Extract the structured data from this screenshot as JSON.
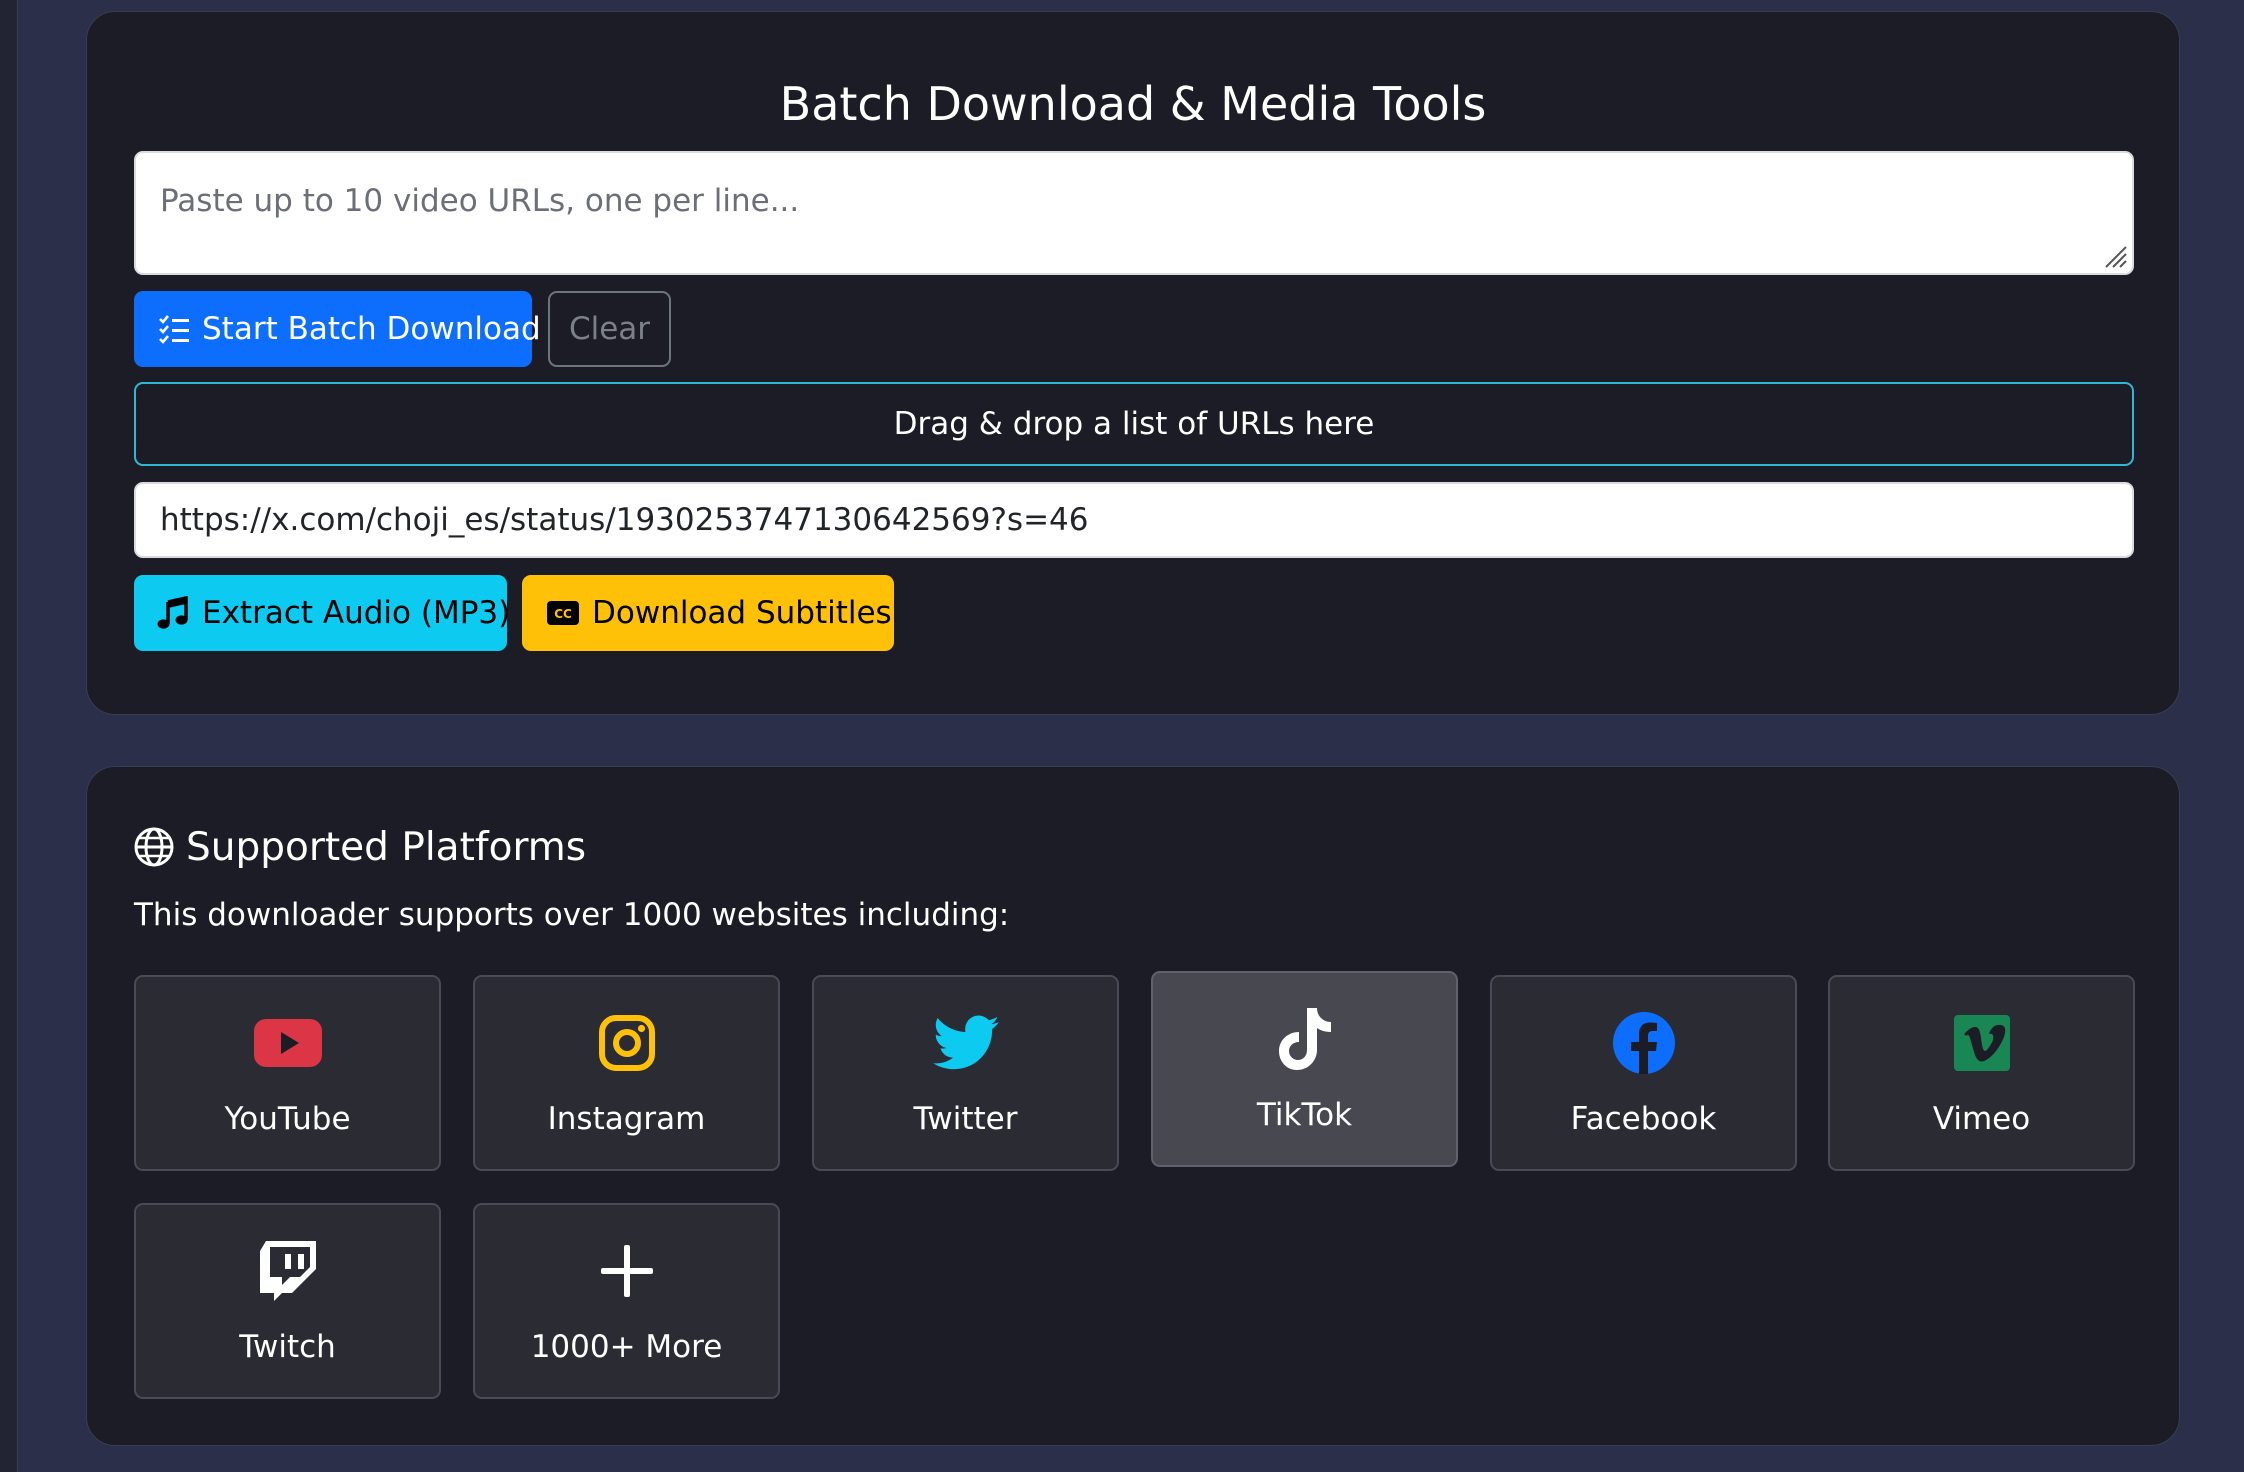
{
  "batch": {
    "title": "Batch Download & Media Tools",
    "textarea_placeholder": "Paste up to 10 video URLs, one per line...",
    "start_label": "Start Batch Download",
    "clear_label": "Clear",
    "dropzone_label": "Drag & drop a list of URLs here",
    "url_value": "https://x.com/choji_es/status/1930253747130642569?s=46",
    "extract_audio_label": "Extract Audio (MP3)",
    "subtitles_label": "Download Subtitles"
  },
  "platforms": {
    "title": "Supported Platforms",
    "description": "This downloader supports over 1000 websites including:",
    "items": [
      {
        "label": "YouTube",
        "icon": "youtube-icon",
        "color": "#dc3545"
      },
      {
        "label": "Instagram",
        "icon": "instagram-icon",
        "color": "#ffc107"
      },
      {
        "label": "Twitter",
        "icon": "twitter-icon",
        "color": "#0dcaf0"
      },
      {
        "label": "TikTok",
        "icon": "tiktok-icon",
        "color": "#ffffff"
      },
      {
        "label": "Facebook",
        "icon": "facebook-icon",
        "color": "#0d6efd"
      },
      {
        "label": "Vimeo",
        "icon": "vimeo-icon",
        "color": "#198754"
      },
      {
        "label": "Twitch",
        "icon": "twitch-icon",
        "color": "#ffffff"
      },
      {
        "label": "1000+ More",
        "icon": "plus-icon",
        "color": "#ffffff"
      }
    ]
  },
  "colors": {
    "primary": "#0d6efd",
    "info": "#0dcaf0",
    "warning": "#ffc107",
    "card_bg": "#1b1c26",
    "page_bg": "#2c2f49"
  }
}
